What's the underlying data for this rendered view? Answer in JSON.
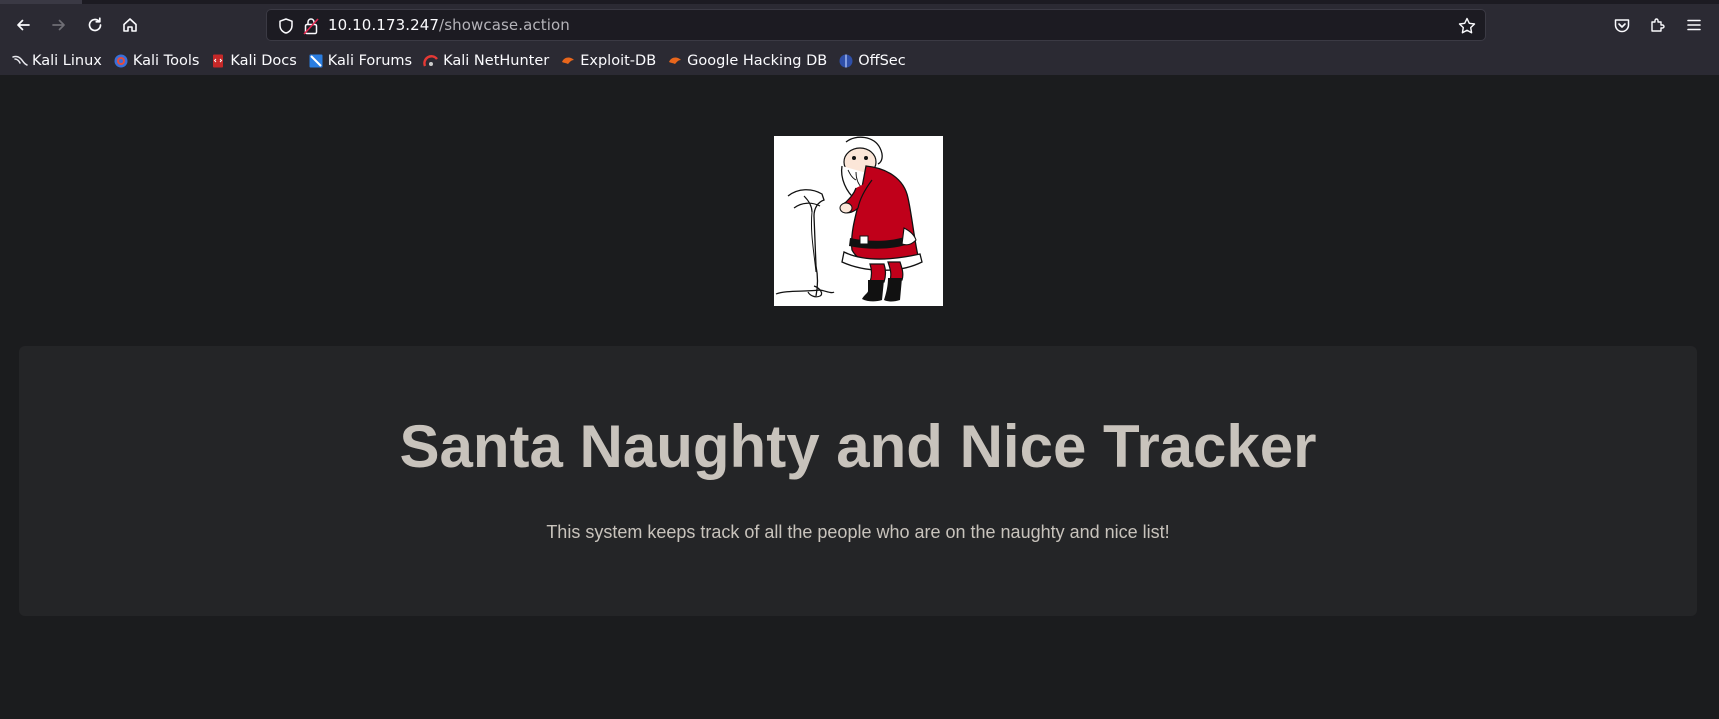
{
  "browser": {
    "url_host": "10.10.173.247",
    "url_path": "/showcase.action",
    "bookmarks": [
      {
        "label": "Kali Linux",
        "icon": "kali-dragon-icon"
      },
      {
        "label": "Kali Tools",
        "icon": "kali-tools-icon"
      },
      {
        "label": "Kali Docs",
        "icon": "kali-docs-icon"
      },
      {
        "label": "Kali Forums",
        "icon": "kali-forums-icon"
      },
      {
        "label": "Kali NetHunter",
        "icon": "nethunter-icon"
      },
      {
        "label": "Exploit-DB",
        "icon": "exploit-db-icon"
      },
      {
        "label": "Google Hacking DB",
        "icon": "ghdb-icon"
      },
      {
        "label": "OffSec",
        "icon": "offsec-icon"
      }
    ]
  },
  "page": {
    "heading": "Santa Naughty and Nice Tracker",
    "tagline": "This system keeps track of all the people who are on the naughty and nice list!",
    "image_alt": "Santa reading list"
  },
  "colors": {
    "page_bg": "#1b1c1e",
    "panel_bg": "#242527",
    "text": "#c8c3bc",
    "santa_red": "#c0001a"
  }
}
